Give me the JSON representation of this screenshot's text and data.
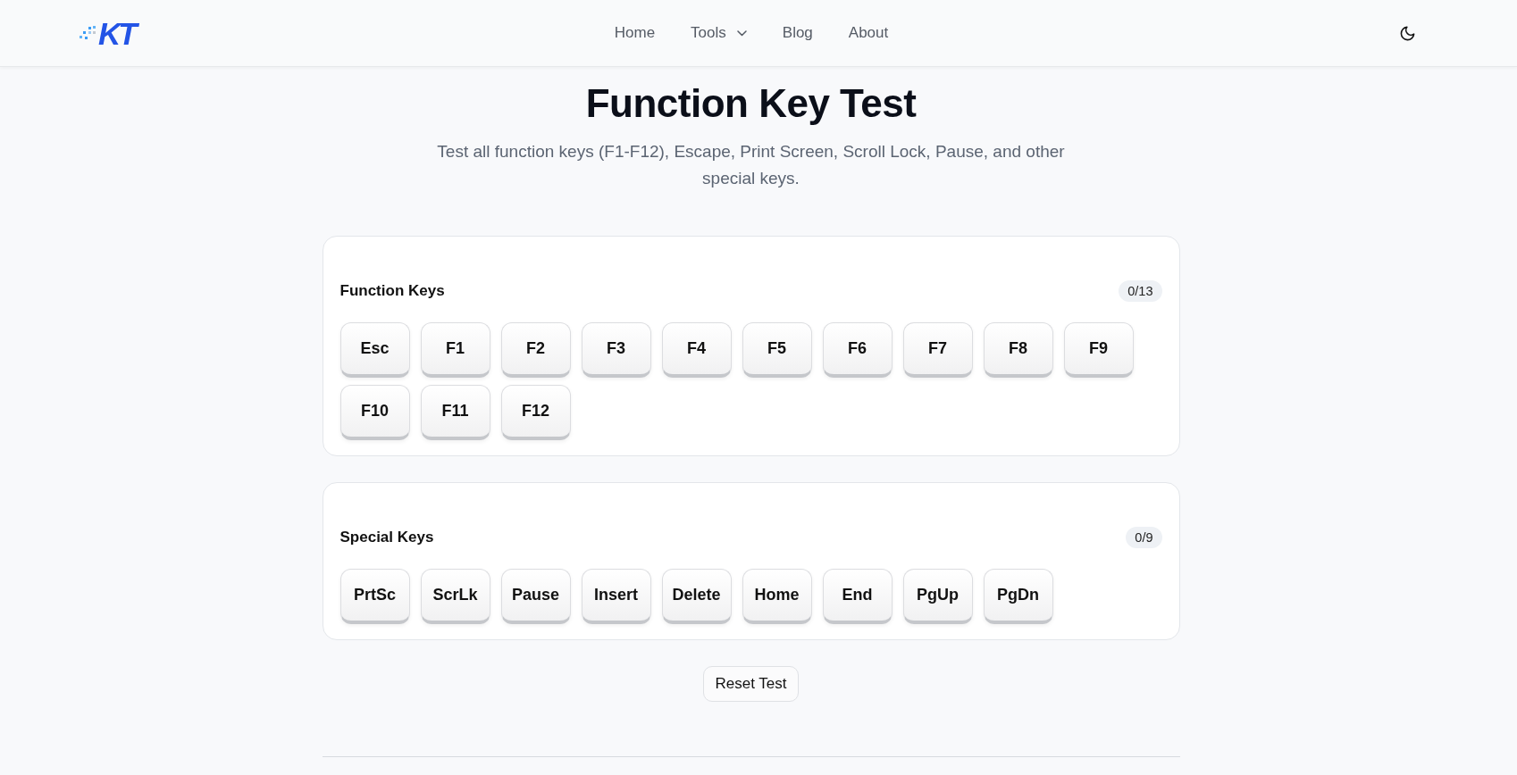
{
  "navbar": {
    "logo": "KT",
    "links": [
      {
        "label": "Home",
        "dropdown": false
      },
      {
        "label": "Tools",
        "dropdown": true
      },
      {
        "label": "Blog",
        "dropdown": false
      },
      {
        "label": "About",
        "dropdown": false
      }
    ]
  },
  "header": {
    "title": "Function Key Test",
    "subtitle": "Test all function keys (F1-F12), Escape, Print Screen, Scroll Lock, Pause, and other special keys."
  },
  "sections": [
    {
      "title": "Function Keys",
      "count": "0/13",
      "keys": [
        "Esc",
        "F1",
        "F2",
        "F3",
        "F4",
        "F5",
        "F6",
        "F7",
        "F8",
        "F9",
        "F10",
        "F11",
        "F12"
      ]
    },
    {
      "title": "Special Keys",
      "count": "0/9",
      "keys": [
        "PrtSc",
        "ScrLk",
        "Pause",
        "Insert",
        "Delete",
        "Home",
        "End",
        "PgUp",
        "PgDn"
      ]
    }
  ],
  "reset_button": "Reset Test"
}
